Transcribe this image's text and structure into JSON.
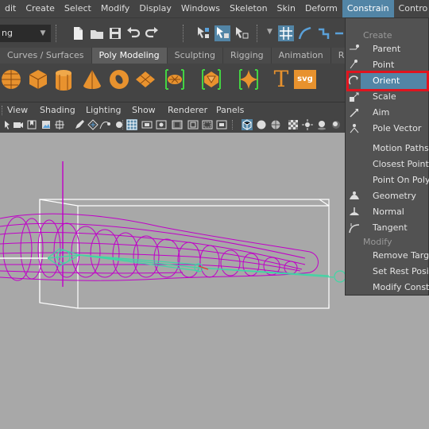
{
  "menubar": {
    "items": [
      "dit",
      "Create",
      "Select",
      "Modify",
      "Display",
      "Windows",
      "Skeleton",
      "Skin",
      "Deform",
      "Constrain",
      "Contro"
    ],
    "active": "Constrain"
  },
  "statusline": {
    "mode": "ng"
  },
  "shelf": {
    "tabs": [
      "Curves / Surfaces",
      "Poly Modeling",
      "Sculpting",
      "Rigging",
      "Animation",
      "R"
    ],
    "active_tab": "Poly Modeling",
    "text_tool_glyph": "T",
    "svg_tool_label": "svg"
  },
  "panel": {
    "menus": [
      "View",
      "Shading",
      "Lighting",
      "Show",
      "Renderer",
      "Panels"
    ]
  },
  "constrain_menu": {
    "create_header": "Create",
    "create_items": [
      "Parent",
      "Point",
      "Orient",
      "Scale",
      "Aim",
      "Pole Vector",
      "Motion Paths",
      "Closest Point",
      "Point On Poly",
      "Geometry",
      "Normal",
      "Tangent"
    ],
    "highlighted": "Orient",
    "modify_header": "Modify",
    "modify_items": [
      "Remove Target",
      "Set Rest Position",
      "Modify Constr"
    ]
  },
  "colors": {
    "accent_blue": "#5285a6",
    "highlight_red": "#e0141e",
    "wire_magenta": "#c000c8",
    "joint_green": "#3fd6a4",
    "viewport_bg": "#a8a8a8"
  }
}
